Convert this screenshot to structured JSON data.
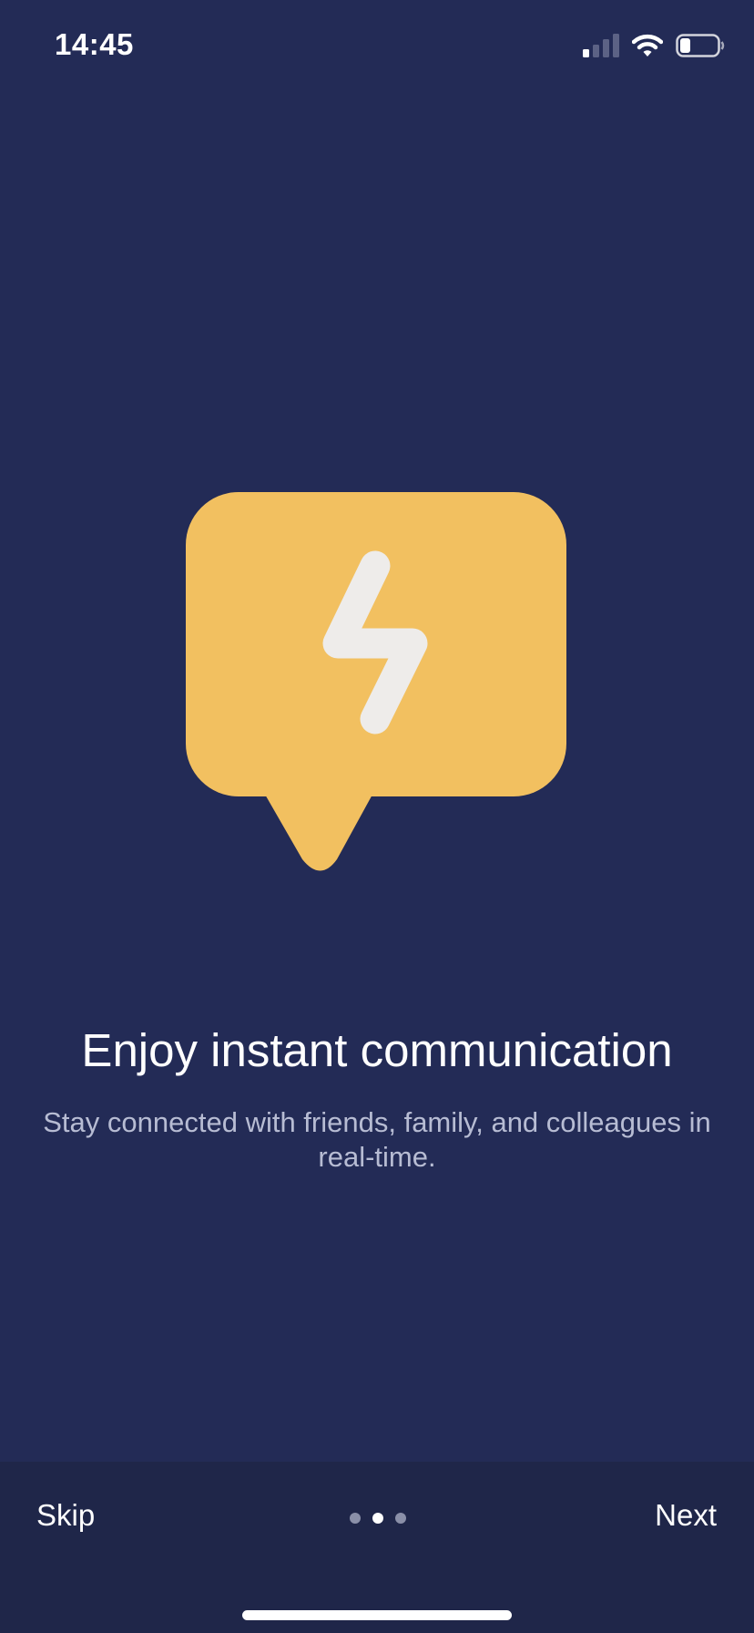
{
  "status_bar": {
    "time": "14:45",
    "icons": [
      "cellular-signal-icon",
      "wifi-icon",
      "battery-icon"
    ]
  },
  "illustration": {
    "icon": "lightning-chat-bubble-icon",
    "bubble_color": "#F2C060",
    "bolt_color": "#EEECEA"
  },
  "onboarding": {
    "title": "Enjoy instant communication",
    "description": "Stay connected with friends, family, and colleagues in real-time."
  },
  "navigation": {
    "skip_label": "Skip",
    "next_label": "Next",
    "page_count": 3,
    "current_page": 2
  },
  "colors": {
    "background": "#232B56",
    "bottom_bar": "#1F2649",
    "subtitle_text": "#B7BCD3",
    "inactive_dot": "#8A8FA8"
  }
}
